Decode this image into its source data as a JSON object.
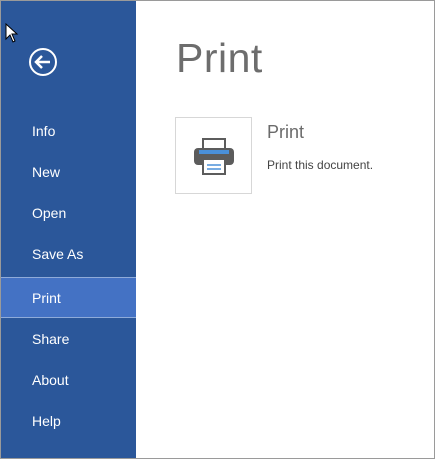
{
  "sidebar": {
    "back_icon": "back-arrow-circle-icon",
    "items": [
      {
        "label": "Info",
        "active": false
      },
      {
        "label": "New",
        "active": false
      },
      {
        "label": "Open",
        "active": false
      },
      {
        "label": "Save As",
        "active": false
      },
      {
        "label": "Print",
        "active": true
      },
      {
        "label": "Share",
        "active": false
      },
      {
        "label": "About",
        "active": false
      },
      {
        "label": "Help",
        "active": false
      }
    ]
  },
  "main": {
    "title": "Print",
    "print_option": {
      "icon": "printer-icon",
      "title": "Print",
      "description": "Print this document."
    }
  },
  "colors": {
    "sidebar_bg": "#2b579a",
    "sidebar_active_bg": "#4472c4",
    "title_text": "#6d6d6d"
  }
}
